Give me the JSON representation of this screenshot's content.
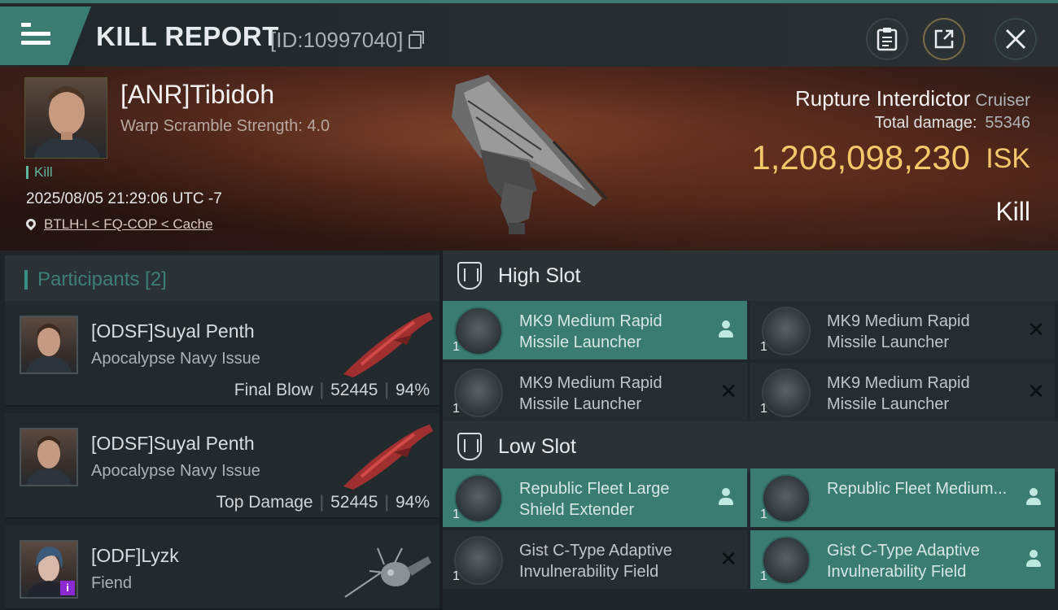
{
  "header": {
    "title": "KILL REPORT",
    "report_id": "[ID:10997040]"
  },
  "victim": {
    "name": "[ANR]Tibidoh",
    "scramble": "Warp Scramble Strength: 4.0",
    "tag": "Kill",
    "date": "2025/08/05 21:29:06 UTC -7",
    "location": "BTLH-I < FQ-COP < Cache",
    "ship_name": "Rupture Interdictor",
    "ship_class": "Cruiser",
    "total_damage_label": "Total damage:",
    "total_damage": "55346",
    "isk_value": "1,208,098,230",
    "isk_unit": "ISK",
    "kill_label": "Kill"
  },
  "participants": {
    "header": "Participants [2]",
    "rows": [
      {
        "name": "[ODSF]Suyal Penth",
        "ship": "Apocalypse Navy Issue",
        "role": "Final Blow",
        "damage": "52445",
        "percent": "94%"
      },
      {
        "name": "[ODSF]Suyal Penth",
        "ship": "Apocalypse Navy Issue",
        "role": "Top Damage",
        "damage": "52445",
        "percent": "94%"
      },
      {
        "name": "[ODF]Lyzk",
        "ship": "Fiend",
        "badge": "i"
      }
    ]
  },
  "slots": {
    "high": {
      "title": "High Slot",
      "modules": [
        {
          "name": "MK9 Medium Rapid Missile Launcher",
          "qty": "1",
          "status": "dropped"
        },
        {
          "name": "MK9 Medium Rapid Missile Launcher",
          "qty": "1",
          "status": "destroyed"
        },
        {
          "name": "MK9 Medium Rapid Missile Launcher",
          "qty": "1",
          "status": "destroyed"
        },
        {
          "name": "MK9 Medium Rapid Missile Launcher",
          "qty": "1",
          "status": "destroyed"
        }
      ]
    },
    "low": {
      "title": "Low Slot",
      "modules": [
        {
          "name": "Republic Fleet Large Shield Extender",
          "qty": "1",
          "status": "dropped"
        },
        {
          "name": "Republic Fleet Medium...",
          "qty": "1",
          "status": "dropped"
        },
        {
          "name": "Gist C-Type Adaptive Invulnerability Field",
          "qty": "1",
          "status": "destroyed"
        },
        {
          "name": "Gist C-Type Adaptive Invulnerability Field",
          "qty": "1",
          "status": "dropped"
        }
      ]
    }
  },
  "colors": {
    "accent": "#3a7c70",
    "isk": "#f2c86a"
  }
}
